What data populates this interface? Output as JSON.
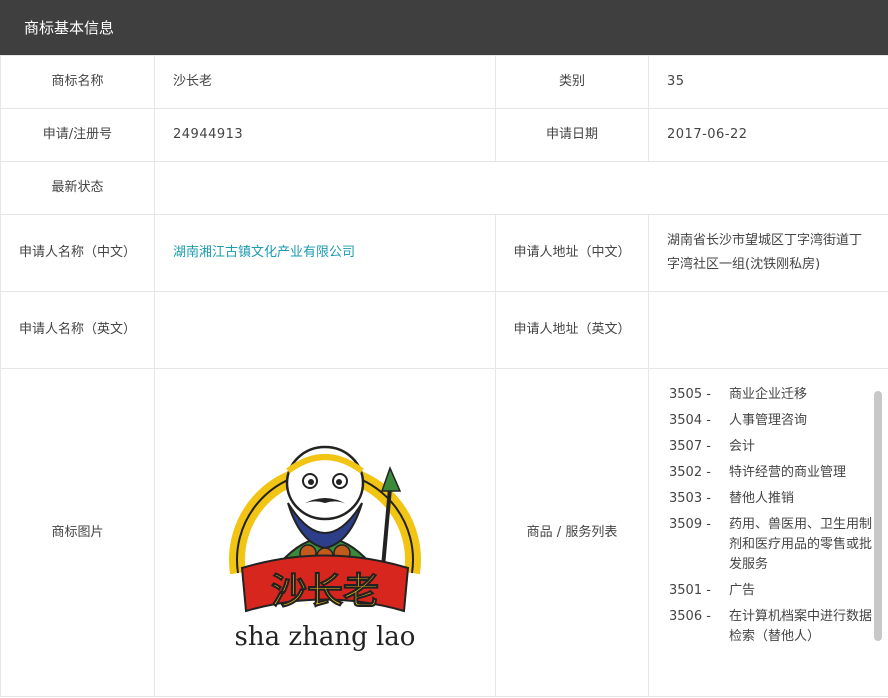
{
  "header": {
    "title": "商标基本信息"
  },
  "labels": {
    "name": "商标名称",
    "class": "类别",
    "reg_no": "申请/注册号",
    "apply_date": "申请日期",
    "status": "最新状态",
    "applicant_cn": "申请人名称（中文）",
    "address_cn": "申请人地址（中文）",
    "applicant_en": "申请人名称（英文）",
    "address_en": "申请人地址（英文）",
    "image": "商标图片",
    "services": "商品 / 服务列表"
  },
  "values": {
    "name": "沙长老",
    "class": "35",
    "reg_no": "24944913",
    "apply_date": "2017-06-22",
    "status": "",
    "applicant_cn": "湖南湘江古镇文化产业有限公司",
    "address_cn": "湖南省长沙市望城区丁字湾街道丁字湾社区一组(沈铁刚私房)",
    "applicant_en": "",
    "address_en": ""
  },
  "logo": {
    "chinese": "沙长老",
    "pinyin": "sha zhang lao",
    "colors": {
      "yellow": "#f2c413",
      "red": "#d7261e",
      "green": "#3a8a3a",
      "dark": "#222222",
      "beard": "#2d3f8a"
    }
  },
  "services": [
    {
      "code": "3505 -",
      "name": "商业企业迁移"
    },
    {
      "code": "3504 -",
      "name": "人事管理咨询"
    },
    {
      "code": "3507 -",
      "name": "会计"
    },
    {
      "code": "3502 -",
      "name": "特许经营的商业管理"
    },
    {
      "code": "3503 -",
      "name": "替他人推销"
    },
    {
      "code": "3509 -",
      "name": "药用、兽医用、卫生用制剂和医疗用品的零售或批发服务"
    },
    {
      "code": "3501 -",
      "name": "广告"
    },
    {
      "code": "3506 -",
      "name": "在计算机档案中进行数据检索（替他人）"
    }
  ]
}
